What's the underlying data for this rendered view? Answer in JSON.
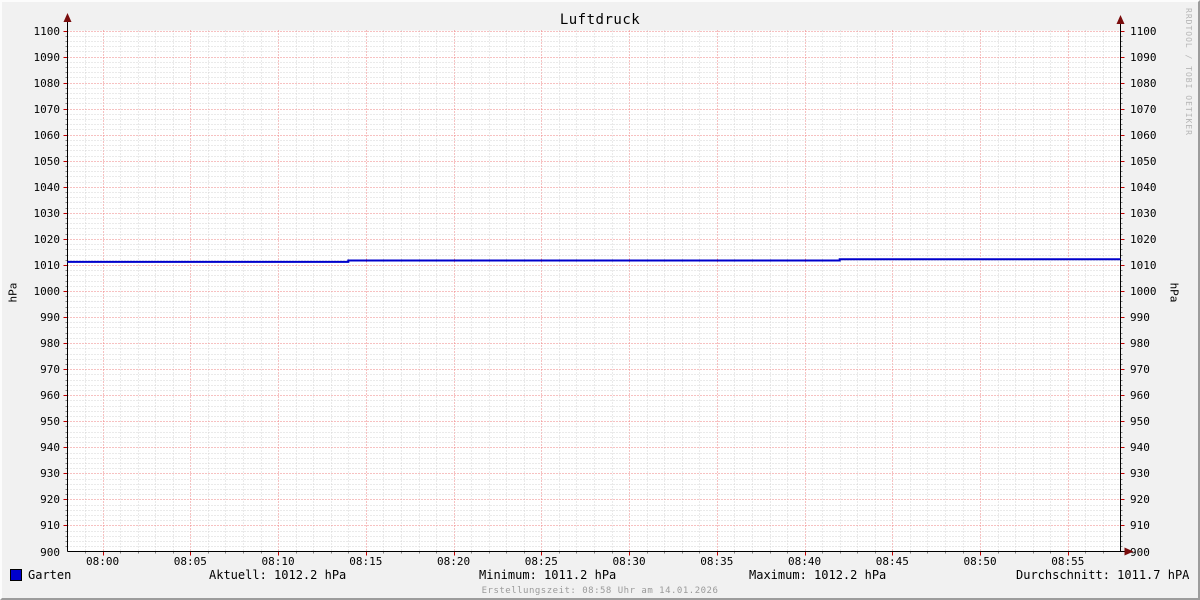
{
  "chart_data": {
    "type": "line",
    "style": "step",
    "title": "Luftdruck",
    "ylabel_left": "hPa",
    "ylabel_right": "hPa",
    "x_axis": {
      "start": "07:58",
      "end": "08:58",
      "start_min": 478,
      "end_min": 538,
      "major_step_min": 5,
      "minor_step_min": 1,
      "ticks": [
        {
          "min": 480,
          "label": "08:00"
        },
        {
          "min": 485,
          "label": "08:05"
        },
        {
          "min": 490,
          "label": "08:10"
        },
        {
          "min": 495,
          "label": "08:15"
        },
        {
          "min": 500,
          "label": "08:20"
        },
        {
          "min": 505,
          "label": "08:25"
        },
        {
          "min": 510,
          "label": "08:30"
        },
        {
          "min": 515,
          "label": "08:35"
        },
        {
          "min": 520,
          "label": "08:40"
        },
        {
          "min": 525,
          "label": "08:45"
        },
        {
          "min": 530,
          "label": "08:50"
        },
        {
          "min": 535,
          "label": "08:55"
        }
      ]
    },
    "y_axis": {
      "min": 900,
      "max": 1100,
      "major_step": 10,
      "minor_step": 2,
      "tick_labels": [
        1100,
        1090,
        1080,
        1070,
        1060,
        1050,
        1040,
        1030,
        1020,
        1010,
        1000,
        990,
        980,
        970,
        960,
        950,
        940,
        930,
        920,
        910,
        900
      ]
    },
    "series": [
      {
        "name": "Garten",
        "color": "#0000cc",
        "unit": "hPa",
        "points": [
          {
            "t": "07:58",
            "v": 1011.2
          },
          {
            "t": "08:14",
            "v": 1011.2
          },
          {
            "t": "08:14",
            "v": 1011.7
          },
          {
            "t": "08:42",
            "v": 1011.7
          },
          {
            "t": "08:42",
            "v": 1012.2
          },
          {
            "t": "08:58",
            "v": 1012.2
          }
        ]
      }
    ],
    "stats": {
      "current": 1012.2,
      "minimum": 1011.2,
      "maximum": 1012.2,
      "average": 1011.7,
      "unit": "hPa"
    },
    "grid": true,
    "legend_position": "bottom"
  },
  "legend": {
    "series_label": "Garten",
    "current": "Aktuell: 1012.2 hPa",
    "minimum": "Minimum: 1011.2 hPa",
    "maximum": "Maximum: 1012.2 hPa",
    "average": "Durchschnitt: 1011.7 hPA"
  },
  "footer": {
    "text": "Erstellungszeit: 08:58 Uhr am 14.01.2026"
  },
  "watermark": {
    "text": "RRDTOOL / TOBI OETIKER"
  },
  "colors": {
    "series": "#0000cc",
    "axis": "#000000",
    "arrow": "#7a0d0d",
    "grid_major": "#ef8383",
    "grid_minor": "#d4d4d4",
    "tick_major": "#c00000",
    "tick_minor": "#878787",
    "background": "#f1f1f1",
    "canvas": "#ffffff"
  }
}
